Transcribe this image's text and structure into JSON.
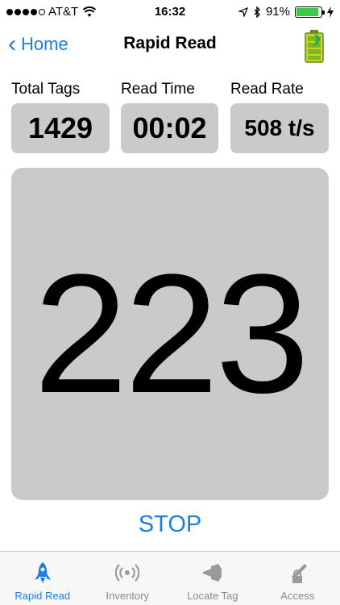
{
  "status_bar": {
    "carrier": "AT&T",
    "time": "16:32",
    "battery_percent": "91%"
  },
  "nav": {
    "back_label": "Home",
    "title": "Rapid Read"
  },
  "stats": {
    "total_tags_label": "Total Tags",
    "total_tags_value": "1429",
    "read_time_label": "Read Time",
    "read_time_value": "00:02",
    "read_rate_label": "Read Rate",
    "read_rate_value": "508 t/s"
  },
  "counter": {
    "value": "223"
  },
  "action": {
    "stop_label": "STOP"
  },
  "tabs": [
    {
      "label": "Rapid Read",
      "icon": "rocket-icon"
    },
    {
      "label": "Inventory",
      "icon": "rfid-signal-icon"
    },
    {
      "label": "Locate Tag",
      "icon": "flashlight-icon"
    },
    {
      "label": "Access",
      "icon": "lock-pen-icon"
    }
  ],
  "colors": {
    "accent": "#1a7fe0",
    "panel": "#cacaca",
    "battery_green": "#3ec845"
  }
}
